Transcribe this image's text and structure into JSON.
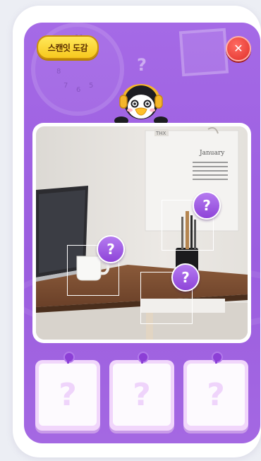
{
  "header": {
    "collection_label": "스캔잇 도감",
    "close_symbol": "✕"
  },
  "background": {
    "deco_mark": "?"
  },
  "game": {
    "hotspots": [
      {
        "mark": "?"
      },
      {
        "mark": "?"
      },
      {
        "mark": "?"
      }
    ],
    "scene_tag": "THX",
    "calendar_title": "January"
  },
  "collection_slots": [
    {
      "mark": "?"
    },
    {
      "mark": "?"
    },
    {
      "mark": "?"
    }
  ],
  "colors": {
    "panel": "#a56ae6",
    "badge": "#8e44d8",
    "collection_button": "#f7c81e",
    "close_button": "#e0302a"
  },
  "icons": [
    "clock-icon",
    "close-icon",
    "question-icon",
    "pin-icon",
    "penguin-mascot-icon"
  ]
}
